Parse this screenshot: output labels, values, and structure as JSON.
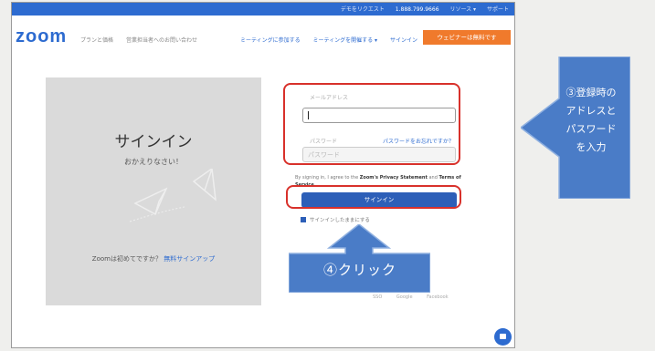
{
  "topbar": {
    "links": [
      "デモをリクエスト",
      "1.888.799.9666",
      "リソース ▾",
      "サポート"
    ]
  },
  "nav": {
    "logo": "zoom",
    "left_links": [
      "プランと価格",
      "営業担当者へのお問い合わせ"
    ],
    "right_links": [
      "ミーティングに参加する",
      "ミーティングを開催する ▾",
      "サインイン"
    ],
    "host_button": "ウェビナーは無料です"
  },
  "left_panel": {
    "title": "サインイン",
    "welcome": "おかえりなさい！",
    "first_time": "Zoomは初めてですか？",
    "signup_link": "無料サインアップ"
  },
  "form": {
    "email_label": "メールアドレス",
    "password_label": "パスワード",
    "forgot_link": "パスワードをお忘れですか？",
    "password_placeholder": "パスワード",
    "terms_text": "By signing in, I agree to the",
    "privacy_link": "Zoom's Privacy Statement",
    "terms_and": "and",
    "terms_link": "Terms of Service",
    "signin_button": "サインイン",
    "stay_signed_in": "サインインしたままにする"
  },
  "footer": {
    "links": [
      "SSO",
      "Google",
      "Facebook"
    ]
  },
  "annotations": {
    "step3": "③登録時の\nアドレスと\nパスワード\nを入力",
    "step4": "④クリック"
  },
  "colors": {
    "zoom_blue": "#2d6bd0",
    "host_orange": "#f07a2c",
    "highlight_red": "#d8312b",
    "callout_blue": "#4a7cc7"
  },
  "icons": [
    "paper-plane-icon",
    "chat-icon",
    "checkbox-icon"
  ]
}
